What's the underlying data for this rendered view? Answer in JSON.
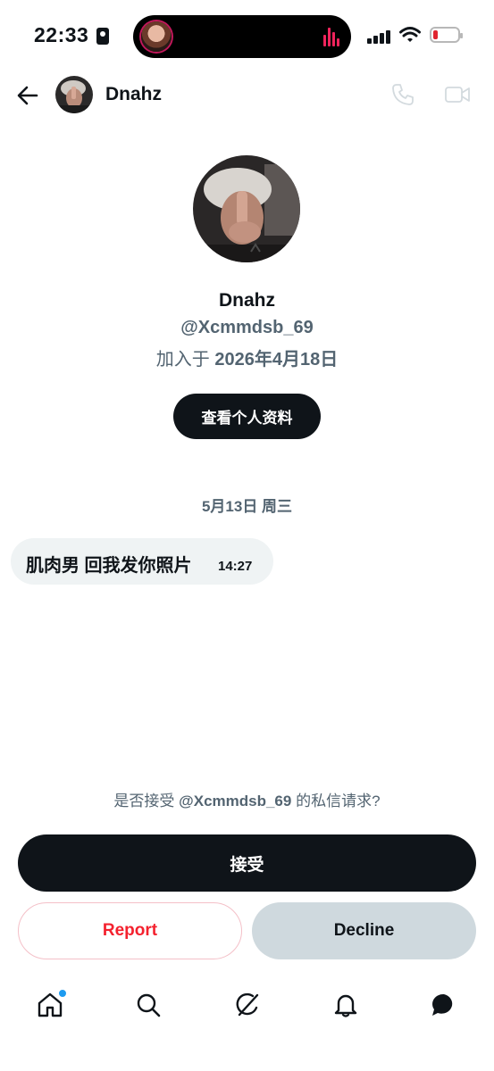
{
  "status_bar": {
    "time": "22:33",
    "battery_level": 0.2,
    "colors": {
      "battery_low": "#e0242f",
      "live_activity": "#f0245c"
    }
  },
  "header": {
    "back_icon": "arrow-left-icon",
    "name": "Dnahz",
    "call_icon": "phone-icon",
    "video_icon": "video-camera-icon"
  },
  "profile": {
    "name": "Dnahz",
    "handle": "@Xcmmdsb_69",
    "joined_prefix": "加入于",
    "joined_date": "2026年4月18日",
    "view_profile_label": "查看个人资料"
  },
  "conversation": {
    "date_separator": "5月13日 周三",
    "messages": [
      {
        "text": "肌肉男 回我发你照片",
        "time": "14:27"
      }
    ]
  },
  "request": {
    "question_prefix": "是否接受",
    "question_handle": "@Xcmmdsb_69",
    "question_suffix": "的私信请求?",
    "accept_label": "接受",
    "report_label": "Report",
    "decline_label": "Decline"
  },
  "tab_bar": {
    "items": [
      {
        "icon": "home-icon",
        "has_notification_dot": true
      },
      {
        "icon": "search-icon"
      },
      {
        "icon": "grok-icon"
      },
      {
        "icon": "bell-icon"
      },
      {
        "icon": "messages-icon",
        "active": true
      }
    ],
    "colors": {
      "dot": "#1d9bf0",
      "text": "#0f1419",
      "danger": "#f4212e"
    }
  }
}
